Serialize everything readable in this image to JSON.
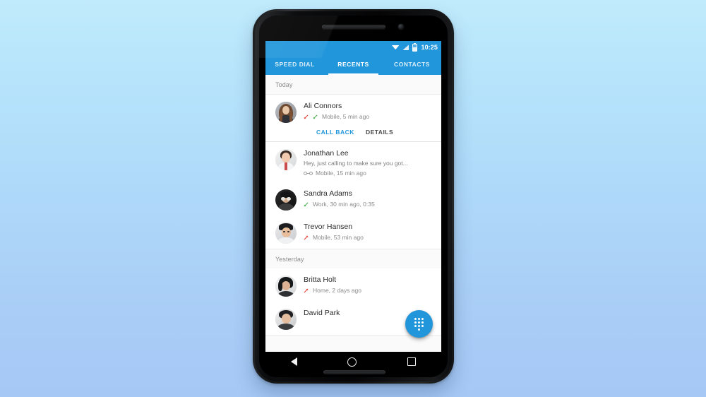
{
  "status_bar": {
    "time": "10:25",
    "icons": [
      "wifi-icon",
      "signal-icon",
      "battery-icon"
    ]
  },
  "tabs": [
    {
      "label": "SPEED DIAL",
      "active": false
    },
    {
      "label": "RECENTS",
      "active": true
    },
    {
      "label": "CONTACTS",
      "active": false
    }
  ],
  "sections": [
    {
      "title": "Today"
    },
    {
      "title": "Yesterday"
    }
  ],
  "calls": {
    "ali": {
      "name": "Ali Connors",
      "meta": "Mobile, 5 min ago",
      "call_types": [
        "missed-call-icon",
        "received-call-icon"
      ],
      "actions": {
        "primary": "CALL BACK",
        "secondary": "DETAILS"
      }
    },
    "jonathan": {
      "name": "Jonathan Lee",
      "preview": "Hey, just calling to make sure you got...",
      "meta": "Mobile, 15 min ago",
      "call_types": [
        "voicemail-icon"
      ]
    },
    "sandra": {
      "name": "Sandra Adams",
      "meta": "Work, 30 min ago, 0:35",
      "call_types": [
        "received-call-icon"
      ]
    },
    "trevor": {
      "name": "Trevor Hansen",
      "meta": "Mobile, 53 min ago",
      "call_types": [
        "outgoing-call-icon"
      ]
    },
    "britta": {
      "name": "Britta Holt",
      "meta": "Home, 2 days ago",
      "call_types": [
        "outgoing-call-icon"
      ]
    },
    "david": {
      "name": "David Park"
    }
  },
  "fab": {
    "icon": "dialpad-icon"
  },
  "nav_bar": {
    "back": "back-icon",
    "home": "home-icon",
    "recents": "recents-icon"
  },
  "colors": {
    "accent": "#2196db",
    "missed": "#e8453c",
    "received": "#4caf50",
    "background_top": "#c0ebfc",
    "background_bottom": "#a6c8f5"
  }
}
